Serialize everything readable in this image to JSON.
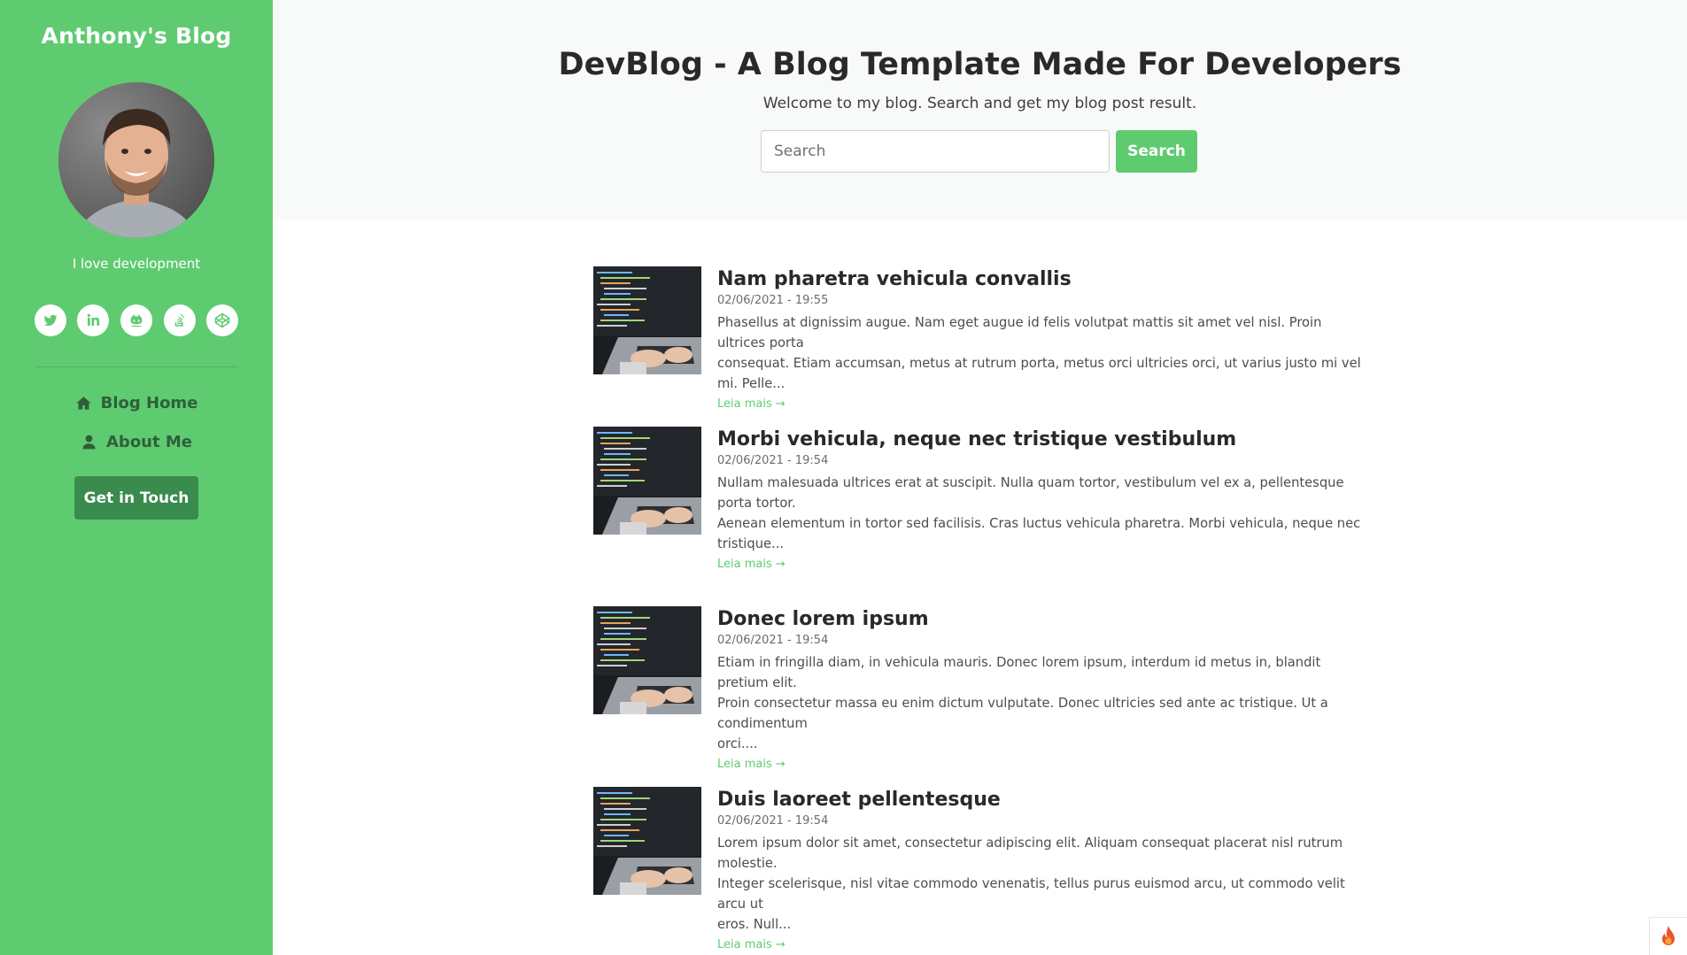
{
  "sidebar": {
    "blog_name": "Anthony's Blog",
    "bio": "I love development",
    "social_links": [
      {
        "icon": "twitter-icon"
      },
      {
        "icon": "linkedin-icon"
      },
      {
        "icon": "github-icon"
      },
      {
        "icon": "stack-overflow-icon"
      },
      {
        "icon": "codepen-icon"
      }
    ],
    "nav": [
      {
        "label": "Blog Home",
        "icon": "home-icon"
      },
      {
        "label": "About Me",
        "icon": "user-icon"
      }
    ],
    "cta_label": "Get in Touch"
  },
  "header": {
    "title": "DevBlog - A Blog Template Made For Developers",
    "subtitle": "Welcome to my blog. Search and get my blog post result.",
    "search_placeholder": "Search",
    "search_button": "Search"
  },
  "posts": [
    {
      "title": "Nam pharetra vehicula convallis",
      "date": "02/06/2021 - 19:55",
      "excerpt_lines": [
        "Phasellus at dignissim augue. Nam eget augue id felis volutpat mattis sit amet vel nisl. Proin ultrices porta",
        "consequat. Etiam accumsan, metus at rutrum porta, metus orci ultricies orci, ut varius justo mi vel mi. Pelle..."
      ],
      "read_more": "Leia mais →"
    },
    {
      "title": "Morbi vehicula, neque nec tristique vestibulum",
      "date": "02/06/2021 - 19:54",
      "excerpt_lines": [
        "Nullam malesuada ultrices erat at suscipit. Nulla quam tortor, vestibulum vel ex a, pellentesque porta tortor.",
        "Aenean elementum in tortor sed facilisis. Cras luctus vehicula pharetra. Morbi vehicula, neque nec",
        "tristique..."
      ],
      "read_more": "Leia mais →"
    },
    {
      "title": "Donec lorem ipsum",
      "date": "02/06/2021 - 19:54",
      "excerpt_lines": [
        "Etiam in fringilla diam, in vehicula mauris. Donec lorem ipsum, interdum id metus in, blandit pretium elit.",
        "Proin consectetur massa eu enim dictum vulputate. Donec ultricies sed ante ac tristique. Ut a condimentum",
        "orci...."
      ],
      "read_more": "Leia mais →"
    },
    {
      "title": "Duis laoreet pellentesque",
      "date": "02/06/2021 - 19:54",
      "excerpt_lines": [
        "Lorem ipsum dolor sit amet, consectetur adipiscing elit. Aliquam consequat placerat nisl rutrum molestie.",
        "Integer scelerisque, nisl vitae commodo venenatis, tellus purus euismod arcu, ut commodo velit arcu ut",
        "eros. Null..."
      ],
      "read_more": "Leia mais →"
    }
  ],
  "corner_badge": {
    "icon": "flame-icon"
  },
  "colors": {
    "accent": "#5fcb71",
    "accent_dark": "#3a8b4e",
    "nav_text": "#2f5f3a",
    "header_bg": "#f8f9f9",
    "text": "#292929"
  }
}
